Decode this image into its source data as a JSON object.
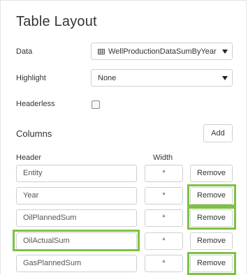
{
  "title": "Table Layout",
  "data_field": {
    "label": "Data",
    "value": "WellProductionDataSumByYear",
    "icon": "table-icon"
  },
  "highlight_field": {
    "label": "Highlight",
    "value": "None"
  },
  "headerless_field": {
    "label": "Headerless",
    "checked": false
  },
  "columns": {
    "title": "Columns",
    "add_label": "Add",
    "header_label": "Header",
    "width_label": "Width",
    "rows": [
      {
        "header": "Entity",
        "width": "*",
        "remove_label": "Remove"
      },
      {
        "header": "Year",
        "width": "*",
        "remove_label": "Remove"
      },
      {
        "header": "OilPlannedSum",
        "width": "*",
        "remove_label": "Remove"
      },
      {
        "header": "OilActualSum",
        "width": "*",
        "remove_label": "Remove"
      },
      {
        "header": "GasPlannedSum",
        "width": "*",
        "remove_label": "Remove"
      }
    ]
  },
  "highlight_color": "#7dc242"
}
